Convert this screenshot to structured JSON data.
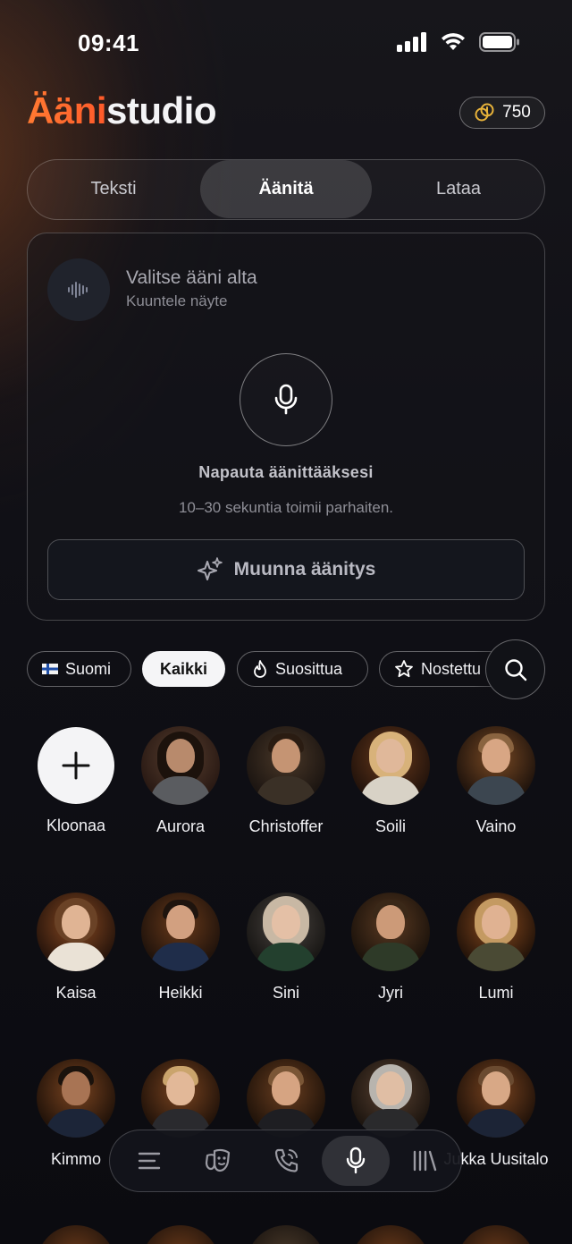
{
  "status_bar": {
    "time": "09:41"
  },
  "header": {
    "title_accent": "Ääni",
    "title_rest": "studio",
    "credits": "750"
  },
  "tabs": [
    {
      "label": "Teksti",
      "active": false
    },
    {
      "label": "Äänitä",
      "active": true
    },
    {
      "label": "Lataa",
      "active": false
    }
  ],
  "record_card": {
    "voice_title": "Valitse ääni alta",
    "voice_subtitle": "Kuuntele näyte",
    "tap_label": "Napauta äänittääksesi",
    "hint": "10–30 sekuntia toimii parhaiten.",
    "convert_label": "Muunna äänitys"
  },
  "filters": [
    {
      "label": "Suomi",
      "icon": "finnish-flag-icon",
      "selected": false
    },
    {
      "label": "Kaikki",
      "icon": "",
      "selected": true
    },
    {
      "label": "Suosittua",
      "icon": "flame-icon",
      "selected": false
    },
    {
      "label": "Nostettu",
      "icon": "star-icon",
      "selected": false
    }
  ],
  "voices": [
    {
      "name": "Kloonaa",
      "type": "add"
    },
    {
      "name": "Aurora"
    },
    {
      "name": "Christoffer"
    },
    {
      "name": "Soili"
    },
    {
      "name": "Vaino"
    },
    {
      "name": "Kaisa"
    },
    {
      "name": "Heikki"
    },
    {
      "name": "Sini"
    },
    {
      "name": "Jyri"
    },
    {
      "name": "Lumi"
    },
    {
      "name": "Kimmo"
    },
    {
      "name": ""
    },
    {
      "name": ""
    },
    {
      "name": ""
    },
    {
      "name": "Jukka Uusitalo"
    }
  ],
  "bottom_nav": [
    {
      "icon": "list-icon",
      "active": false
    },
    {
      "icon": "theater-masks-icon",
      "active": false
    },
    {
      "icon": "phone-call-icon",
      "active": false
    },
    {
      "icon": "microphone-icon",
      "active": true
    },
    {
      "icon": "library-icon",
      "active": false
    }
  ],
  "colors": {
    "accent": "#ff6a2e",
    "background": "#0d0d12"
  }
}
